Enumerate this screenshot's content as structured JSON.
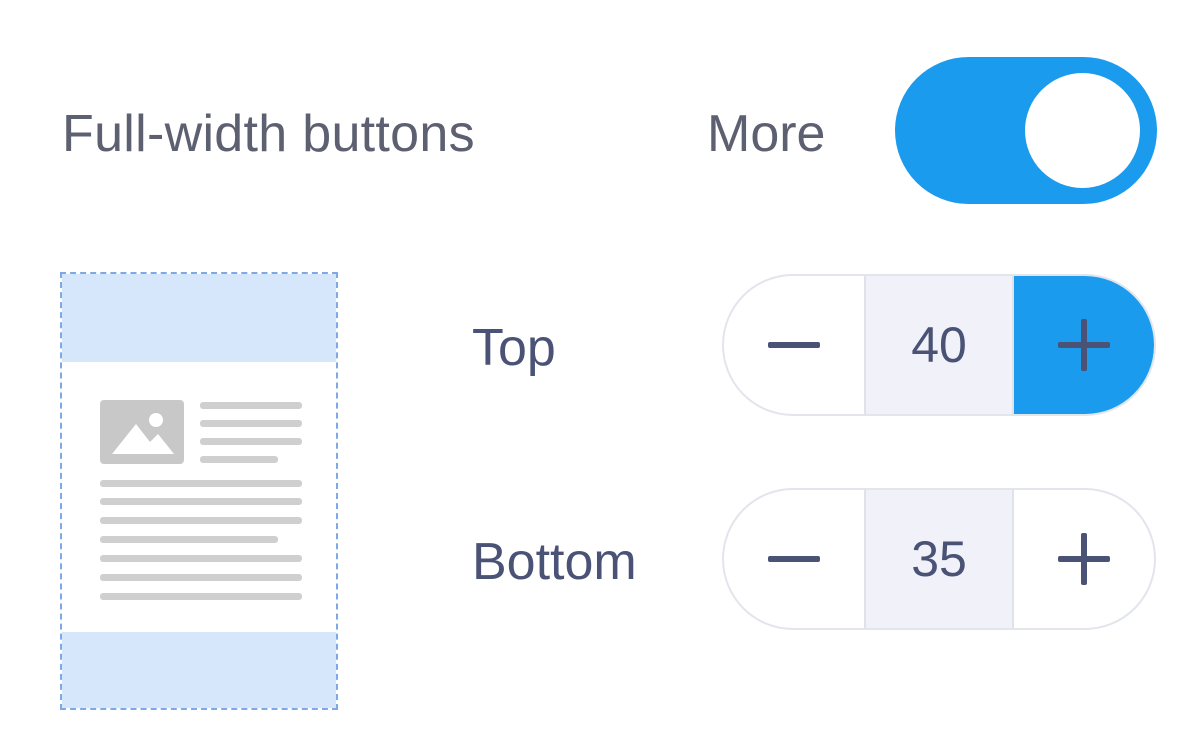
{
  "settings": {
    "full_width_label": "Full-width buttons",
    "toggle_label": "More",
    "toggle_on": true
  },
  "padding": {
    "top": {
      "label": "Top",
      "value": "40",
      "decrement_icon": "minus-icon",
      "increment_icon": "plus-icon"
    },
    "bottom": {
      "label": "Bottom",
      "value": "35",
      "decrement_icon": "minus-icon",
      "increment_icon": "plus-icon"
    }
  },
  "colors": {
    "accent": "#1a9bee",
    "padding_highlight": "#d6e6fb",
    "text": "#4a5276"
  },
  "preview": {
    "icon": "image-placeholder-icon"
  }
}
